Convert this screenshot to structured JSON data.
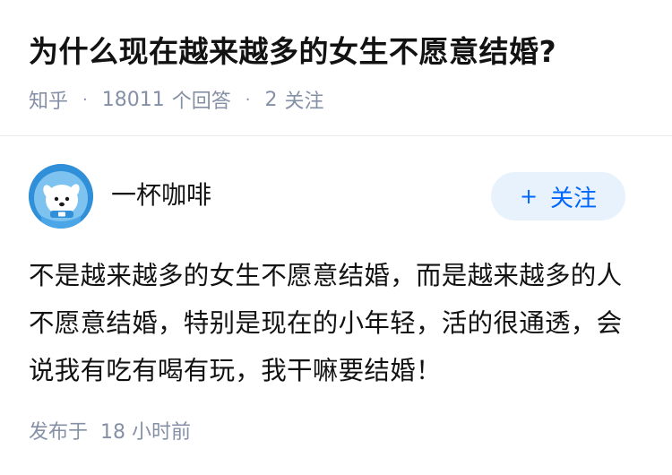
{
  "question": {
    "title": "为什么现在越来越多的女生不愿意结婚?",
    "source": "知乎",
    "answer_count": "18011",
    "answer_label": "个回答",
    "follow_count": "2",
    "follow_label": "关注"
  },
  "author": {
    "name": "一杯咖啡",
    "follow_button_plus": "+",
    "follow_button_label": "关注",
    "avatar_icon": "cartoon-dog-avatar-icon"
  },
  "answer": {
    "text": "不是越来越多的女生不愿意结婚，而是越来越多的人不愿意结婚，特别是现在的小年轻，活的很通透，会说我有吃有喝有玩，我干嘛要结婚！",
    "published_label": "发布于",
    "published_time": "18 小时前"
  },
  "colors": {
    "accent": "#0066ff",
    "follow_button_bg": "#e8f2fc",
    "meta_text": "#8590a6",
    "avatar_bg": "#2f8fd8"
  }
}
